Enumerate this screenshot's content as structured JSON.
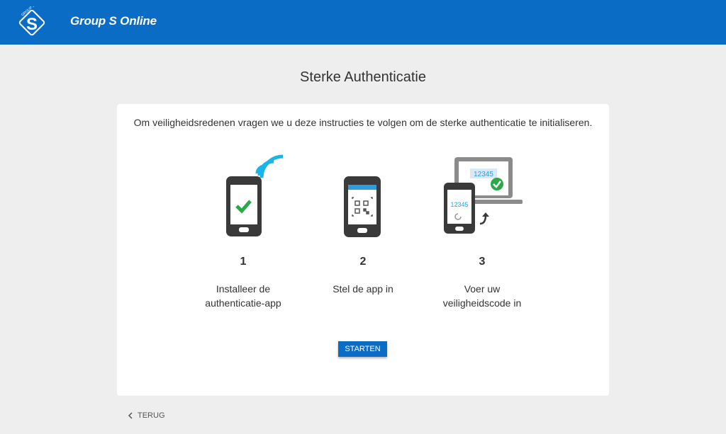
{
  "header": {
    "app_title": "Group S Online",
    "logo_text": "GROUP S",
    "bg_color": "#0a6cc4"
  },
  "page": {
    "title": "Sterke Authenticatie"
  },
  "card": {
    "intro": "Om veiligheidsredenen vragen we u deze instructies te volgen om de sterke authenticatie te initialiseren.",
    "steps": [
      {
        "number": "1",
        "line1": "Installeer de",
        "line2": "authenticatie-app"
      },
      {
        "number": "2",
        "line1": "Stel de app in",
        "line2": ""
      },
      {
        "number": "3",
        "line1": "Voer uw",
        "line2": "veiligheidscode in"
      }
    ],
    "code_laptop": "12345",
    "code_phone": "12345",
    "start_label": "STARTEN"
  },
  "footer": {
    "back_label": "TERUG"
  }
}
